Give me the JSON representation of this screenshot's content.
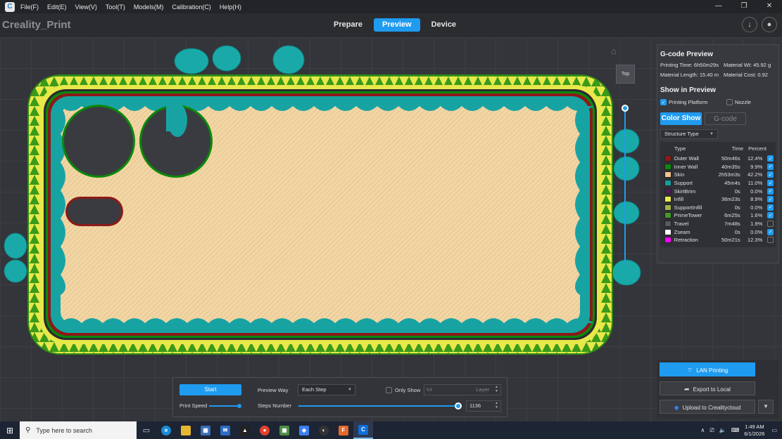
{
  "menu": [
    "File(F)",
    "Edit(E)",
    "View(V)",
    "Tool(T)",
    "Models(M)",
    "Calibration(C)",
    "Help(H)"
  ],
  "brand": "Creality_Print",
  "tabs": [
    {
      "label": "Prepare",
      "active": false
    },
    {
      "label": "Preview",
      "active": true
    },
    {
      "label": "Device",
      "active": false
    }
  ],
  "view_cube_label": "Top",
  "gcode_panel": {
    "title": "G-code Preview",
    "printing_time": "Printing Time: 6h50m29s",
    "material_wt": "Material Wt: 45.92 g",
    "material_length": "Material Length: 15.40 m",
    "material_cost": "Material Cost: 0.92",
    "show_title": "Show in Preview",
    "printing_platform": {
      "label": "Printing Platform",
      "checked": true
    },
    "nozzle": {
      "label": "Nozzle",
      "checked": false
    },
    "color_show_label": "Color Show",
    "gcode_label": "G-code",
    "structure_select": "Structure Type",
    "headers": {
      "type": "Type",
      "time": "Time",
      "percent": "Percent"
    },
    "rows": [
      {
        "type": "Outer Wall",
        "time": "50m46s",
        "percent": "12.4%",
        "color": "#8b1a1a",
        "checked": true
      },
      {
        "type": "Inner Wall",
        "time": "40m35s",
        "percent": "9.9%",
        "color": "#0a8a0a",
        "checked": true
      },
      {
        "type": "Skin",
        "time": "2h53m3s",
        "percent": "42.2%",
        "color": "#f2c38a",
        "checked": true
      },
      {
        "type": "Support",
        "time": "45m4s",
        "percent": "11.0%",
        "color": "#139f9f",
        "checked": true
      },
      {
        "type": "SkirtBrim",
        "time": "0s",
        "percent": "0.0%",
        "color": "#4b1c55",
        "checked": true
      },
      {
        "type": "Infill",
        "time": "36m23s",
        "percent": "8.9%",
        "color": "#e8e84a",
        "checked": true
      },
      {
        "type": "SupportInfill",
        "time": "0s",
        "percent": "0.0%",
        "color": "#a3b04a",
        "checked": true
      },
      {
        "type": "PrimeTower",
        "time": "6m25s",
        "percent": "1.6%",
        "color": "#3f9a2a",
        "checked": true
      },
      {
        "type": "Travel",
        "time": "7m48s",
        "percent": "1.9%",
        "color": "#555a60",
        "checked": false
      },
      {
        "type": "Zseam",
        "time": "0s",
        "percent": "0.0%",
        "color": "#ffffff",
        "checked": true
      },
      {
        "type": "Retraction",
        "time": "50m21s",
        "percent": "12.3%",
        "color": "#ff00ff",
        "checked": false
      }
    ]
  },
  "toolbar": {
    "start_label": "Start",
    "print_speed_label": "Print Speed",
    "preview_way_label": "Preview Way",
    "preview_way_value": "Each Step",
    "only_show_label": "Only Show",
    "only_show_value": "64",
    "layer_unit": "Layer",
    "steps_number_label": "Steps Number",
    "steps_value": "1136"
  },
  "export": {
    "lan": "LAN Printing",
    "local": "Export to Local",
    "cloud": "Upload to Crealitycloud"
  },
  "taskbar": {
    "search_placeholder": "Type here to search",
    "time": "1:49 AM",
    "date": "6/1/2026"
  }
}
